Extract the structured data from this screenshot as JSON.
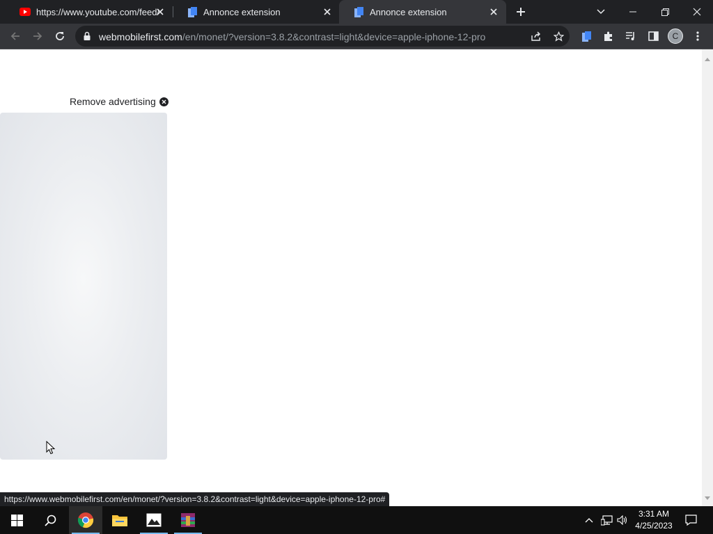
{
  "tabs": [
    {
      "title": "https://www.youtube.com/feed/li",
      "favicon": "youtube-icon",
      "active": false
    },
    {
      "title": "Annonce extension",
      "favicon": "extension-doc-icon",
      "active": false
    },
    {
      "title": "Annonce extension",
      "favicon": "extension-doc-icon",
      "active": true
    }
  ],
  "omnibox": {
    "host": "webmobilefirst.com",
    "path": "/en/monet/?version=3.8.2&contrast=light&device=apple-iphone-12-pro"
  },
  "profile": {
    "initial": "C"
  },
  "page": {
    "remove_ad_label": "Remove advertising"
  },
  "status_bar": {
    "url": "https://www.webmobilefirst.com/en/monet/?version=3.8.2&contrast=light&device=apple-iphone-12-pro#"
  },
  "taskbar": {
    "apps": [
      "windows-start-icon",
      "search-icon",
      "chrome-icon",
      "file-explorer-icon",
      "photos-icon",
      "winrar-icon"
    ],
    "time": "3:31 AM",
    "date": "4/25/2023"
  },
  "colors": {
    "chrome_dark": "#202124",
    "toolbar": "#35363a",
    "page_bg": "#ffffff",
    "ad_placeholder": "#e6e9ed",
    "taskbar": "#101010"
  }
}
